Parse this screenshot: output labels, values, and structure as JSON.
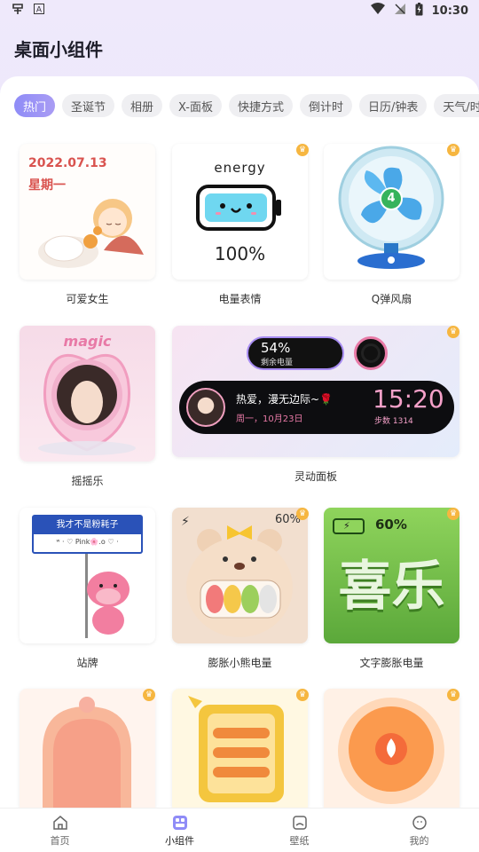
{
  "status": {
    "time": "10:30"
  },
  "header": {
    "title": "桌面小组件"
  },
  "tabs": [
    "热门",
    "圣诞节",
    "相册",
    "X-面板",
    "快捷方式",
    "倒计时",
    "日历/钟表",
    "天气/时"
  ],
  "widgets": {
    "cute_girl": {
      "date": "2022.07.13",
      "weekday": "星期一",
      "caption": "可爱女生"
    },
    "battery_face": {
      "word": "energy",
      "percent": "100%",
      "caption": "电量表情"
    },
    "fan": {
      "number": "4",
      "caption": "Q弹风扇"
    },
    "rocker": {
      "magic": "magic",
      "caption": "摇摇乐"
    },
    "dynamic_panel": {
      "battery_percent": "54%",
      "battery_label": "剩余电量",
      "slogan": "热爱，漫无边际~🌹",
      "date": "周一，10月23日",
      "time": "15:20",
      "steps": "步数 1314",
      "caption": "灵动面板"
    },
    "sign": {
      "title": "我才不是粉耗子",
      "sub": "ʷ · ♡ Pink🌸.o ♡ ·",
      "caption": "站牌"
    },
    "bear": {
      "percent": "60%",
      "caption": "膨胀小熊电量"
    },
    "text_inflate": {
      "percent": "60%",
      "text": "喜乐",
      "caption": "文字膨胀电量"
    }
  },
  "nav": [
    {
      "label": "首页",
      "icon": "home-icon"
    },
    {
      "label": "小组件",
      "icon": "widgets-icon"
    },
    {
      "label": "壁纸",
      "icon": "wallpaper-icon"
    },
    {
      "label": "我的",
      "icon": "profile-icon"
    }
  ],
  "colors": {
    "accent": "#8f8cf7",
    "crown": "#f6b640"
  }
}
